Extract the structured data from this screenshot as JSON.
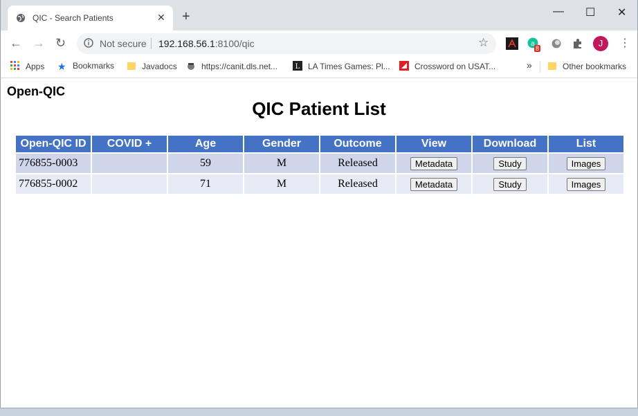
{
  "browser": {
    "tab_title": "QIC - Search Patients",
    "new_tab": "+",
    "window_controls": {
      "minimize": "—",
      "maximize": "☐",
      "close": "✕"
    },
    "security": "Not secure",
    "url_host": "192.168.56.1",
    "url_path": ":8100/qic",
    "profile_initial": "J",
    "extension_badge": "8",
    "bookmarks": {
      "apps": "Apps",
      "items": [
        "Bookmarks",
        "Javadocs",
        "https://canit.dls.net...",
        "LA Times Games: Pl...",
        "Crossword on USAT..."
      ],
      "more": "»",
      "other": "Other bookmarks"
    }
  },
  "page": {
    "brand": "Open-QIC",
    "title": "QIC Patient List",
    "columns": [
      "Open-QIC ID",
      "COVID +",
      "Age",
      "Gender",
      "Outcome",
      "View",
      "Download",
      "List"
    ],
    "rows": [
      {
        "id": "776855-0003",
        "covid": "",
        "age": "59",
        "gender": "M",
        "outcome": "Released",
        "view": "Metadata",
        "download": "Study",
        "list": "Images"
      },
      {
        "id": "776855-0002",
        "covid": "",
        "age": "71",
        "gender": "M",
        "outcome": "Released",
        "view": "Metadata",
        "download": "Study",
        "list": "Images"
      }
    ]
  },
  "colors": {
    "header_bg": "#4472c4",
    "row_odd": "#cfd6ea",
    "row_even": "#e8ebf5"
  }
}
